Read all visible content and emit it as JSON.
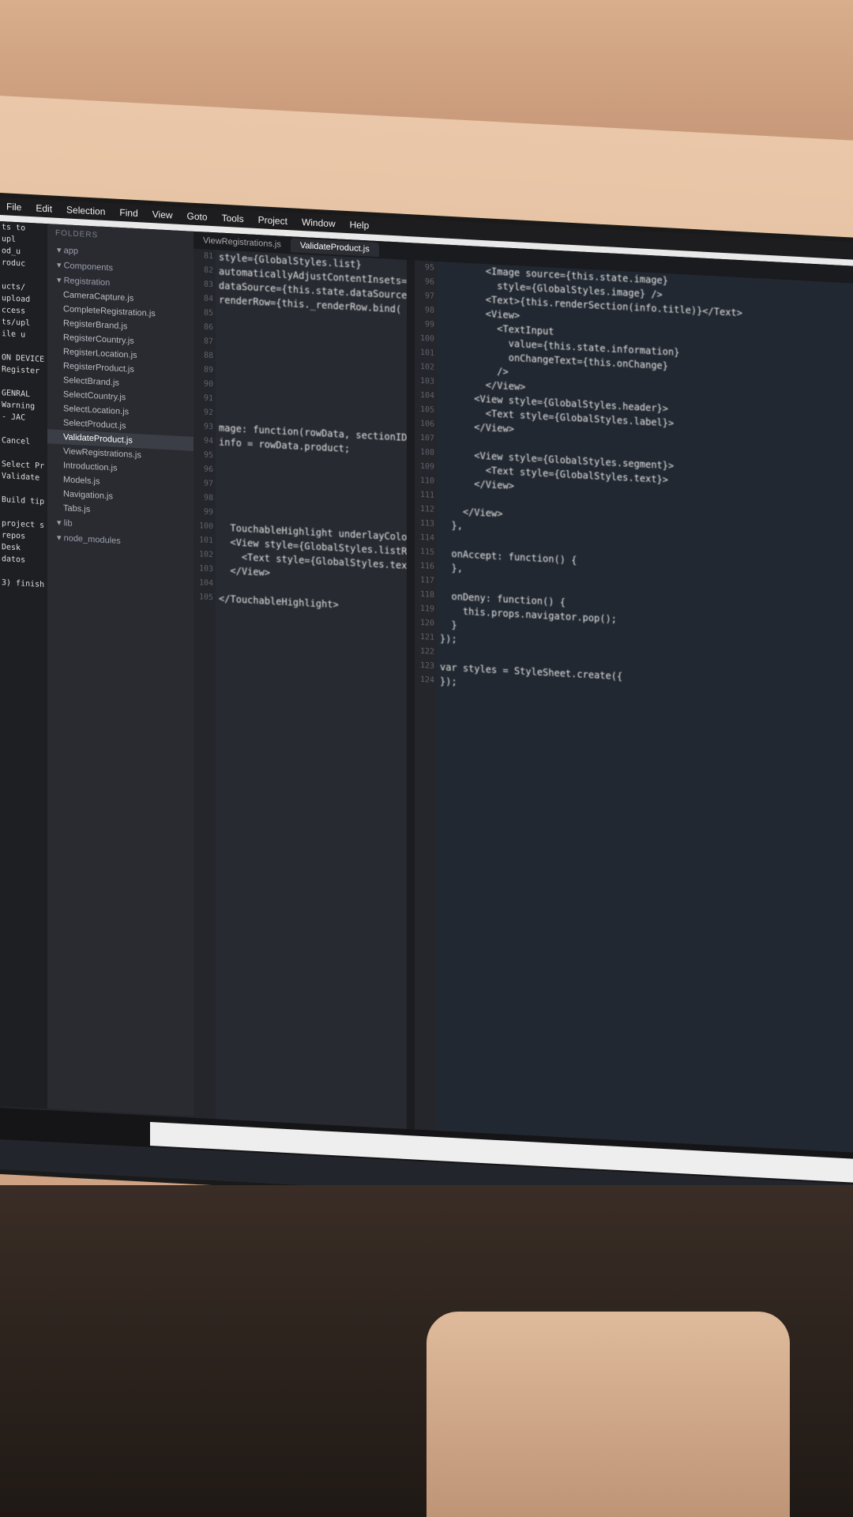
{
  "menu": [
    "File",
    "Edit",
    "Selection",
    "Find",
    "View",
    "Goto",
    "Tools",
    "Project",
    "Window",
    "Help"
  ],
  "sidebar": {
    "header": "FOLDERS",
    "items": [
      {
        "label": "app",
        "type": "folder"
      },
      {
        "label": "Components",
        "type": "folder"
      },
      {
        "label": "Registration",
        "type": "folder"
      },
      {
        "label": "CameraCapture.js",
        "type": "file"
      },
      {
        "label": "CompleteRegistration.js",
        "type": "file"
      },
      {
        "label": "RegisterBrand.js",
        "type": "file"
      },
      {
        "label": "RegisterCountry.js",
        "type": "file"
      },
      {
        "label": "RegisterLocation.js",
        "type": "file"
      },
      {
        "label": "RegisterProduct.js",
        "type": "file"
      },
      {
        "label": "SelectBrand.js",
        "type": "file"
      },
      {
        "label": "SelectCountry.js",
        "type": "file"
      },
      {
        "label": "SelectLocation.js",
        "type": "file"
      },
      {
        "label": "SelectProduct.js",
        "type": "file"
      },
      {
        "label": "ValidateProduct.js",
        "type": "file",
        "active": true
      },
      {
        "label": "ViewRegistrations.js",
        "type": "file"
      },
      {
        "label": "Introduction.js",
        "type": "file"
      },
      {
        "label": "Models.js",
        "type": "file"
      },
      {
        "label": "Navigation.js",
        "type": "file"
      },
      {
        "label": "Tabs.js",
        "type": "file"
      },
      {
        "label": "lib",
        "type": "folder"
      },
      {
        "label": "node_modules",
        "type": "folder"
      }
    ]
  },
  "tabs": [
    "ViewRegistrations.js",
    "ValidateProduct.js"
  ],
  "pane1_lines": [
    "style={GlobalStyles.list}",
    "automaticallyAdjustContentInsets={",
    "dataSource={this.state.dataSource}",
    "renderRow={this._renderRow.bind(",
    "",
    "",
    "",
    "",
    "",
    "",
    "",
    "",
    "mage: function(rowData, sectionID, r",
    "info = rowData.product;",
    "",
    "",
    "",
    "",
    "",
    "  TouchableHighlight underlayColor",
    "  <View style={GlobalStyles.listRow}>",
    "    <Text style={GlobalStyles.text}>",
    "  </View>",
    "",
    "</TouchableHighlight>"
  ],
  "pane2_lines": [
    "        <Image source={this.state.image}",
    "          style={GlobalStyles.image} />",
    "        <Text>{this.renderSection(info.title)}</Text>",
    "        <View>",
    "          <TextInput",
    "            value={this.state.information}",
    "            onChangeText={this.onChange}",
    "          />",
    "        </View>",
    "      <View style={GlobalStyles.header}>",
    "        <Text style={GlobalStyles.label}>",
    "      </View>",
    "",
    "      <View style={GlobalStyles.segment}>",
    "        <Text style={GlobalStyles.text}>",
    "      </View>",
    "",
    "    </View>",
    "  },",
    "",
    "  onAccept: function() {",
    "  },",
    "",
    "  onDeny: function() {",
    "    this.props.navigator.pop();",
    "  }",
    "});",
    "",
    "var styles = StyleSheet.create({",
    "});"
  ],
  "terminal_lines": [
    "ts to",
    "upl",
    "od_u",
    "roduc",
    "",
    "ucts/",
    "upload",
    "ccess",
    "ts/upl",
    "ile u",
    "",
    "ON DEVICE",
    "Register",
    "",
    "GENRAL",
    "Warning",
    "- JAC",
    "",
    "Cancel",
    "",
    "Select Pr",
    "Validate",
    "",
    "Build tip",
    "",
    "project s",
    "repos",
    "Desk",
    "datos",
    "",
    "3) finish"
  ]
}
